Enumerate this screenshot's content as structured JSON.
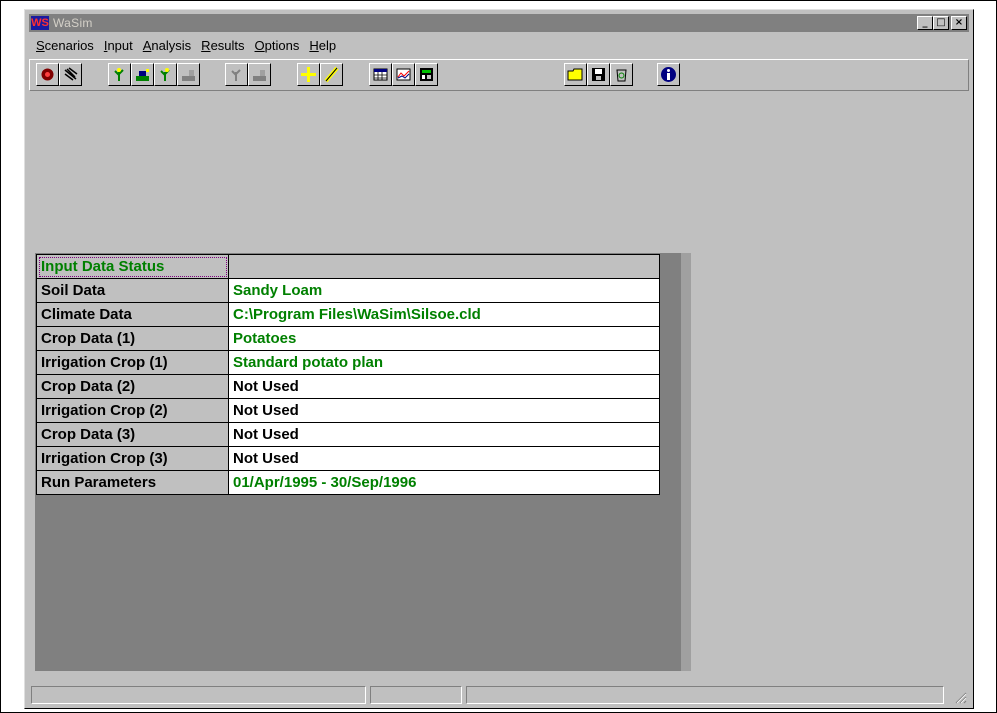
{
  "window": {
    "title": "WaSim",
    "logo_text": "WS",
    "controls": [
      "_",
      "□",
      "×"
    ]
  },
  "menu": [
    "Scenarios",
    "Input",
    "Analysis",
    "Results",
    "Options",
    "Help"
  ],
  "toolbar": {
    "buttons": [
      "scenario-open-icon",
      "scenario-wizard-icon",
      "soil-icon",
      "climate-icon",
      "crop-icon",
      "irrigation-icon",
      "crop-disabled-icon",
      "irrigation-disabled-icon",
      "add-icon",
      "edit-pencil-icon",
      "table-icon",
      "chart-icon",
      "calculator-icon",
      "folder-open-icon",
      "save-icon",
      "recycle-icon",
      "info-icon"
    ]
  },
  "status_table": {
    "header": "Input Data Status",
    "rows": [
      {
        "label": "Soil Data",
        "value": "Sandy Loam",
        "color": "#008000"
      },
      {
        "label": "Climate Data",
        "value": "C:\\Program Files\\WaSim\\Silsoe.cld",
        "color": "#008000"
      },
      {
        "label": "Crop Data (1)",
        "value": "Potatoes",
        "color": "#008000"
      },
      {
        "label": "Irrigation Crop (1)",
        "value": "Standard potato plan",
        "color": "#008000"
      },
      {
        "label": "Crop Data (2)",
        "value": "Not Used",
        "color": "#000000"
      },
      {
        "label": "Irrigation Crop (2)",
        "value": "Not Used",
        "color": "#000000"
      },
      {
        "label": "Crop Data (3)",
        "value": "Not Used",
        "color": "#000000"
      },
      {
        "label": "Irrigation Crop (3)",
        "value": "Not Used",
        "color": "#000000"
      },
      {
        "label": "Run Parameters",
        "value": "01/Apr/1995 - 30/Sep/1996",
        "color": "#008000"
      }
    ]
  },
  "colors": {
    "title_bar": "#808080",
    "ok_value": "#008000",
    "unused_value": "#000000"
  }
}
